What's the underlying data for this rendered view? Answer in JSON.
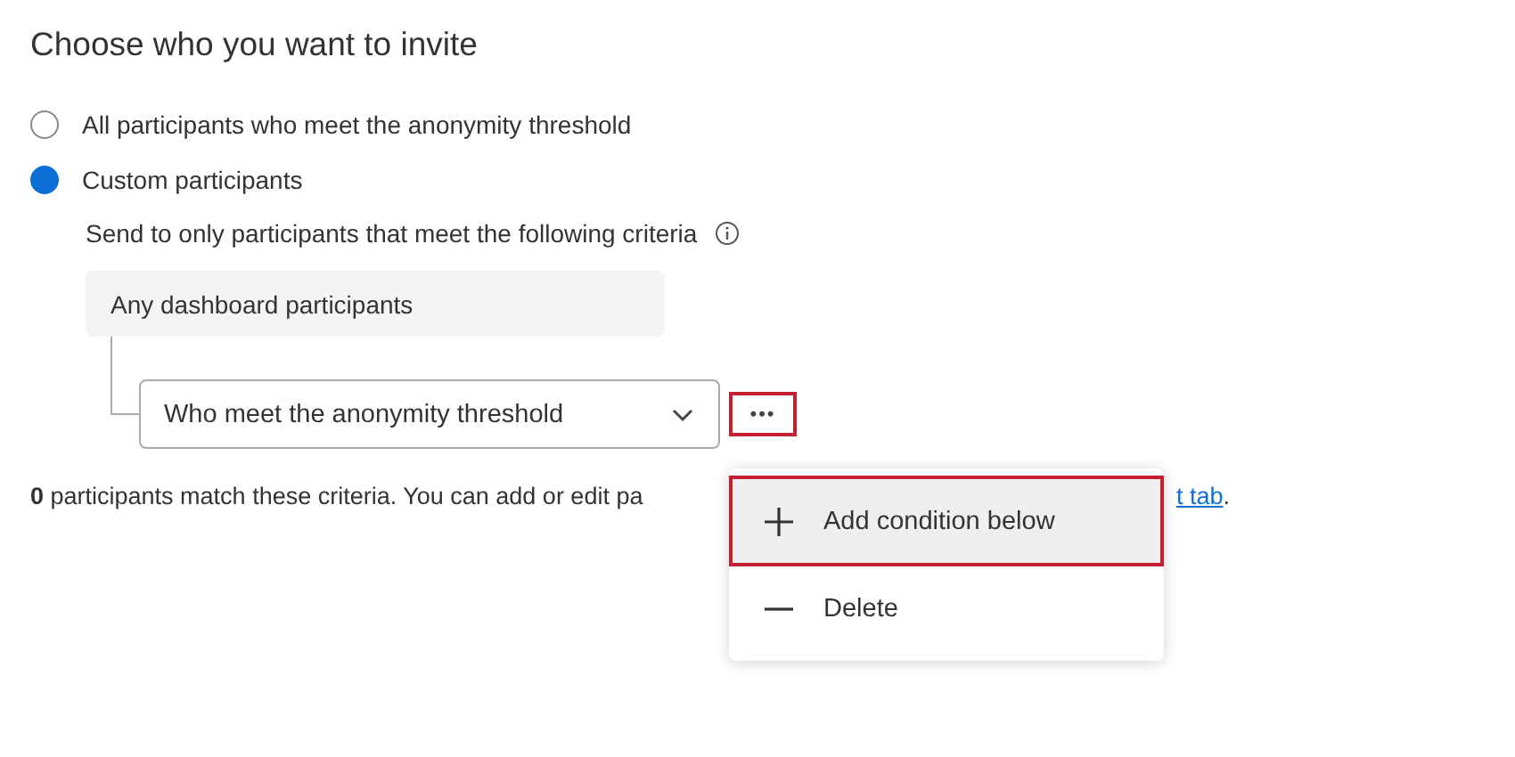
{
  "title": "Choose who you want to invite",
  "options": [
    {
      "label": "All participants who meet the anonymity threshold",
      "selected": false
    },
    {
      "label": "Custom participants",
      "selected": true
    }
  ],
  "criteria": {
    "description": "Send to only participants that meet the following criteria",
    "group": "Any dashboard participants",
    "condition": {
      "value": "Who meet the anonymity threshold"
    },
    "more_button": {
      "label": "•••",
      "highlighted": true
    }
  },
  "footer": {
    "text": "**0** participants match these criteria. You can add or edit pa",
    "link": "t tab",
    "tail": "."
  },
  "menu": [
    {
      "kind": "add",
      "label": "Add condition below",
      "highlighted": true
    },
    {
      "kind": "delete",
      "label": "Delete",
      "highlighted": false
    }
  ]
}
